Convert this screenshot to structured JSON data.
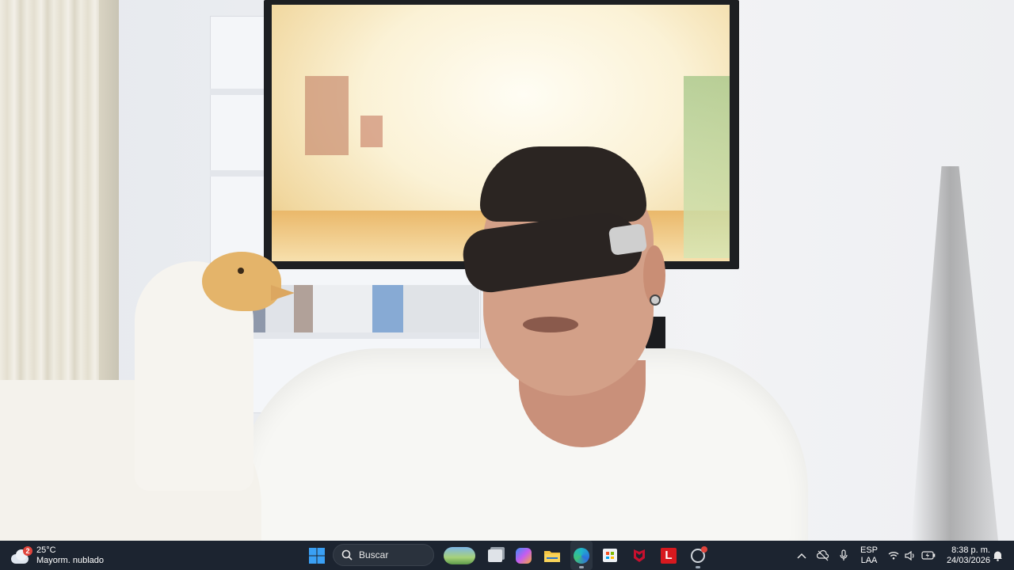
{
  "taskbar": {
    "weather": {
      "temperature": "25°C",
      "condition": "Mayorm. nublado",
      "badge_count": "2",
      "icon": "cloud-icon"
    },
    "start_icon": "windows-logo-icon",
    "search": {
      "label": "Buscar",
      "icon": "search-icon"
    },
    "pinned_apps": [
      {
        "name": "widgets-icon"
      },
      {
        "name": "task-view-icon"
      },
      {
        "name": "copilot-icon"
      },
      {
        "name": "file-explorer-icon"
      },
      {
        "name": "edge-browser-icon"
      },
      {
        "name": "microsoft-store-icon"
      },
      {
        "name": "mcafee-icon"
      },
      {
        "name": "l-app-icon"
      },
      {
        "name": "chrome-canary-icon"
      }
    ],
    "tray": {
      "language_line1": "ESP",
      "language_line2": "LAA",
      "time": "8:38 p. m.",
      "date": "24/03/2026"
    },
    "colors": {
      "taskbar_bg": "#1c2430",
      "windows_blue": "#3aa0f5",
      "edge_teal": "#1fb6c9",
      "folder_yellow": "#f5c542",
      "mcafee_red": "#c8102e",
      "notification_red": "#e0443c"
    }
  }
}
